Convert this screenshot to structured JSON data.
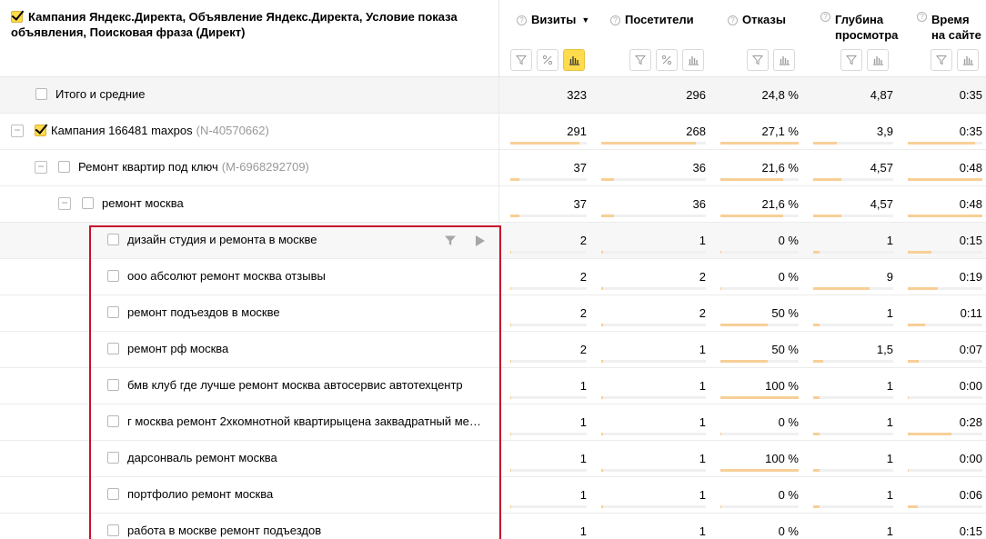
{
  "header": {
    "dimension_title": "Кампания Яндекс.Директа, Объявление Яндекс.Директа, Условие показа объявления, Поисковая фраза (Директ)",
    "metrics": [
      {
        "label": "Визиты",
        "sorted": "▼"
      },
      {
        "label": "Посетители"
      },
      {
        "label": "Отказы"
      },
      {
        "label": "Глубина просмотра"
      },
      {
        "label": "Время на сайте"
      }
    ],
    "help_glyph": "?"
  },
  "total": {
    "label": "Итого и средние",
    "values": [
      "323",
      "296",
      "24,8 %",
      "4,87",
      "0:35"
    ]
  },
  "rows": [
    {
      "label": "Кампания 166481 maxpos",
      "id": "(N-40570662)",
      "level": 0,
      "checked": true,
      "values": [
        "291",
        "268",
        "27,1 %",
        "3,9",
        "0:35"
      ],
      "bars": [
        0.9,
        0.9,
        1.0,
        0.3,
        0.9
      ]
    },
    {
      "label": "Ремонт квартир под ключ",
      "id": "(M-6968292709)",
      "level": 1,
      "checked": false,
      "values": [
        "37",
        "36",
        "21,6 %",
        "4,57",
        "0:48"
      ],
      "bars": [
        0.12,
        0.12,
        0.8,
        0.35,
        1.0
      ]
    },
    {
      "label": "ремонт москва",
      "id": "",
      "level": 2,
      "checked": false,
      "values": [
        "37",
        "36",
        "21,6 %",
        "4,57",
        "0:48"
      ],
      "bars": [
        0.12,
        0.12,
        0.8,
        0.35,
        1.0
      ]
    },
    {
      "label": "дизайн студия и ремонта в москве",
      "id": "",
      "level": 3,
      "checked": false,
      "values": [
        "2",
        "1",
        "0 %",
        "1",
        "0:15"
      ],
      "bars": [
        0.01,
        0.0,
        0.0,
        0.08,
        0.32
      ]
    },
    {
      "label": "ооо абсолют ремонт москва отзывы",
      "id": "",
      "level": 3,
      "checked": false,
      "values": [
        "2",
        "2",
        "0 %",
        "9",
        "0:19"
      ],
      "bars": [
        0.01,
        0.01,
        0.0,
        0.7,
        0.4
      ]
    },
    {
      "label": "ремонт подъездов в москве",
      "id": "",
      "level": 3,
      "checked": false,
      "values": [
        "2",
        "2",
        "50 %",
        "1",
        "0:11"
      ],
      "bars": [
        0.01,
        0.01,
        0.6,
        0.08,
        0.23
      ]
    },
    {
      "label": "ремонт рф москва",
      "id": "",
      "level": 3,
      "checked": false,
      "values": [
        "2",
        "1",
        "50 %",
        "1,5",
        "0:07"
      ],
      "bars": [
        0.01,
        0.0,
        0.6,
        0.12,
        0.15
      ]
    },
    {
      "label": "бмв клуб где лучше ремонт москва автосервис автотехцентр",
      "id": "",
      "level": 3,
      "checked": false,
      "values": [
        "1",
        "1",
        "100 %",
        "1",
        "0:00"
      ],
      "bars": [
        0.0,
        0.0,
        1.0,
        0.08,
        0.0
      ]
    },
    {
      "label": "г москва ремонт 2хкомнотной квартирыцена заквадратный ме…",
      "id": "",
      "level": 3,
      "checked": false,
      "values": [
        "1",
        "1",
        "0 %",
        "1",
        "0:28"
      ],
      "bars": [
        0.0,
        0.0,
        0.0,
        0.08,
        0.58
      ]
    },
    {
      "label": "дарсонваль ремонт москва",
      "id": "",
      "level": 3,
      "checked": false,
      "values": [
        "1",
        "1",
        "100 %",
        "1",
        "0:00"
      ],
      "bars": [
        0.0,
        0.0,
        1.0,
        0.08,
        0.0
      ]
    },
    {
      "label": "портфолио ремонт москва",
      "id": "",
      "level": 3,
      "checked": false,
      "values": [
        "1",
        "1",
        "0 %",
        "1",
        "0:06"
      ],
      "bars": [
        0.0,
        0.0,
        0.0,
        0.08,
        0.13
      ]
    },
    {
      "label": "работа в москве ремонт подъездов",
      "id": "",
      "level": 3,
      "checked": false,
      "values": [
        "1",
        "1",
        "0 %",
        "1",
        "0:15"
      ],
      "bars": [
        0.0,
        0.0,
        0.0,
        0.08,
        0.3
      ]
    }
  ],
  "toggle_glyph": "−",
  "icons": {
    "filter": "filter-icon",
    "percent": "percent-icon",
    "chart": "bar-chart-icon",
    "play": "play-icon"
  },
  "colors": {
    "accent": "#ffdb4d",
    "bar": "#f7cf97",
    "highlight": "#c8102e"
  }
}
